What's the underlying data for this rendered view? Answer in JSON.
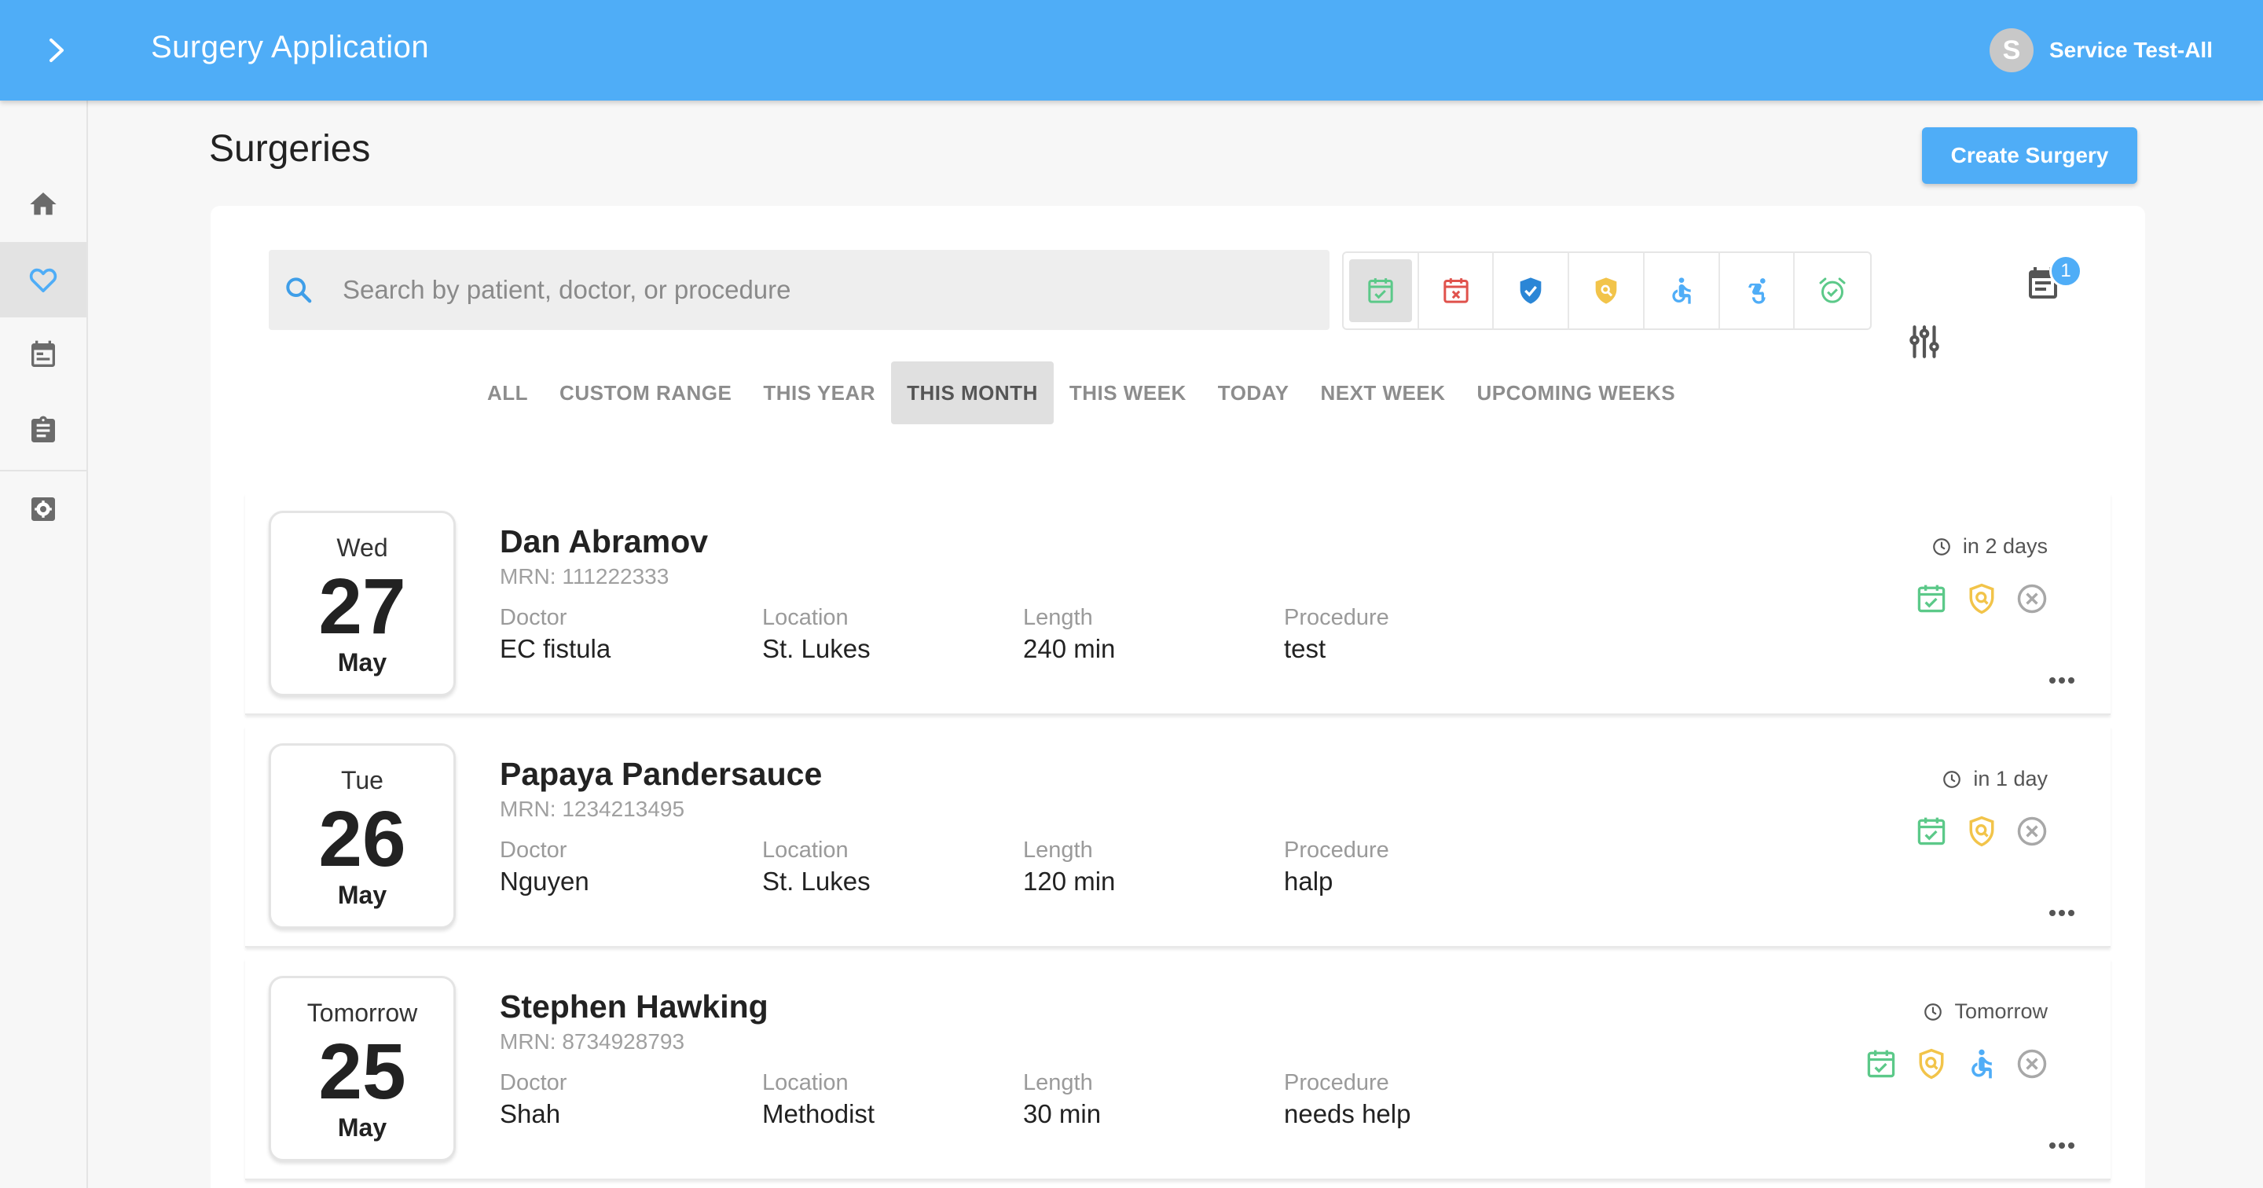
{
  "app": {
    "title": "Surgery Application",
    "user_initial": "S",
    "user_name": "Service Test-All",
    "brand_color": "#4fadf7"
  },
  "sidebar": {
    "items": [
      {
        "icon": "home-icon"
      },
      {
        "icon": "heart-icon",
        "active": true
      },
      {
        "icon": "calendar-icon"
      },
      {
        "icon": "clipboard-icon"
      },
      {
        "icon": "settings-icon"
      }
    ]
  },
  "page": {
    "title": "Surgeries",
    "create_label": "Create Surgery"
  },
  "search": {
    "placeholder": "Search by patient, doctor, or procedure",
    "value": ""
  },
  "status_filters": [
    {
      "icon": "calendar-check-icon",
      "color": "#5cc989",
      "selected": true
    },
    {
      "icon": "calendar-x-icon",
      "color": "#e0524c"
    },
    {
      "icon": "shield-check-icon",
      "color": "#2b86d6"
    },
    {
      "icon": "shield-search-icon",
      "color": "#f2c44a"
    },
    {
      "icon": "accessible-icon",
      "color": "#4fadf7"
    },
    {
      "icon": "accessible-forward-icon",
      "color": "#4fadf7"
    },
    {
      "icon": "alarm-check-icon",
      "color": "#5cc989"
    }
  ],
  "notifications": {
    "count": "1"
  },
  "range_tabs": {
    "items": [
      "ALL",
      "CUSTOM RANGE",
      "THIS YEAR",
      "THIS MONTH",
      "THIS WEEK",
      "TODAY",
      "NEXT WEEK",
      "UPCOMING WEEKS"
    ],
    "selected": "THIS MONTH"
  },
  "labels": {
    "doctor": "Doctor",
    "location": "Location",
    "length": "Length",
    "procedure": "Procedure"
  },
  "surgeries": [
    {
      "dow": "Wed",
      "day": "27",
      "month": "May",
      "name": "Dan Abramov",
      "mrn": "MRN: 111222333",
      "doctor": "EC fistula",
      "location": "St. Lukes",
      "length": "240 min",
      "procedure": "test",
      "when": "in 2 days",
      "status_icons": [
        "calendar-check-icon",
        "shield-search-icon",
        "cancel-icon"
      ]
    },
    {
      "dow": "Tue",
      "day": "26",
      "month": "May",
      "name": "Papaya Pandersauce",
      "mrn": "MRN: 1234213495",
      "doctor": "Nguyen",
      "location": "St. Lukes",
      "length": "120 min",
      "procedure": "halp",
      "when": "in 1 day",
      "status_icons": [
        "calendar-check-icon",
        "shield-search-icon",
        "cancel-icon"
      ]
    },
    {
      "dow": "Tomorrow",
      "day": "25",
      "month": "May",
      "name": "Stephen Hawking",
      "mrn": "MRN: 8734928793",
      "doctor": "Shah",
      "location": "Methodist",
      "length": "30 min",
      "procedure": "needs help",
      "when": "Tomorrow",
      "status_icons": [
        "calendar-check-icon",
        "shield-search-icon",
        "accessible-icon",
        "cancel-icon"
      ]
    }
  ]
}
